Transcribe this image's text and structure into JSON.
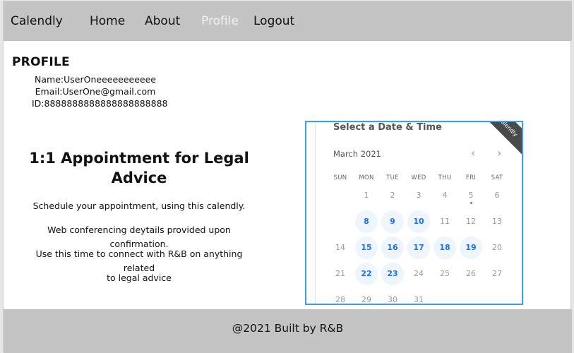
{
  "nav": {
    "brand": "Calendly",
    "items": [
      {
        "label": "Home"
      },
      {
        "label": "About"
      },
      {
        "label": "Profile"
      },
      {
        "label": "Logout"
      }
    ]
  },
  "profile": {
    "title": "PROFILE",
    "name": "Name:UserOneeeeeeeeeee",
    "email": "Email:UserOne@gmail.com",
    "id": "ID:8888888888888888888888"
  },
  "appointment": {
    "title_line1": "1:1 Appointment for Legal",
    "title_line2": "Advice",
    "lines": [
      "Schedule your appointment, using this calendly.",
      "Web conferencing deytails provided upon confirmation.",
      "Use this time to connect with R&B on anything related",
      "to legal advice"
    ]
  },
  "calendar": {
    "header": "Select a Date & Time",
    "ribbon": "Calendly",
    "month": "March 2021",
    "prev": "‹",
    "next": "›",
    "weekdays": [
      "SUN",
      "MON",
      "TUE",
      "WED",
      "THU",
      "FRI",
      "SAT"
    ],
    "weeks": [
      [
        "",
        "1",
        "2",
        "3",
        "4",
        "5",
        "6"
      ],
      [
        "",
        "8",
        "9",
        "10",
        "11",
        "12",
        "13"
      ],
      [
        "14",
        "15",
        "16",
        "17",
        "18",
        "19",
        "20"
      ],
      [
        "21",
        "22",
        "23",
        "24",
        "25",
        "26",
        "27"
      ],
      [
        "28",
        "29",
        "30",
        "31",
        "",
        "",
        ""
      ]
    ],
    "available": [
      "8",
      "9",
      "10",
      "15",
      "16",
      "17",
      "18",
      "19",
      "22",
      "23"
    ],
    "today": "5",
    "colors": {
      "accent": "#1a73e8",
      "border": "#3aa0e8"
    }
  },
  "footer": {
    "text": "@2021 Built by R&B"
  }
}
